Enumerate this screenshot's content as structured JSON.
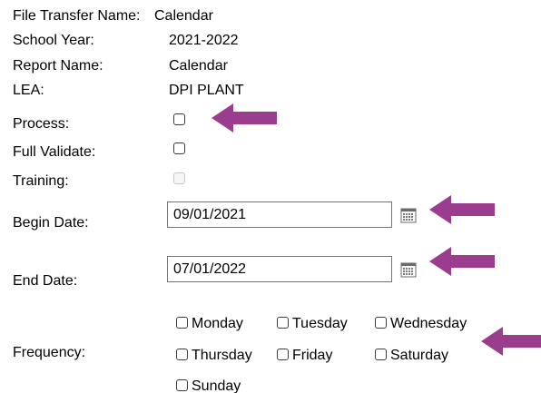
{
  "info": {
    "file_transfer_name_label": "File Transfer Name:",
    "file_transfer_name_value": "Calendar",
    "school_year_label": "School Year:",
    "school_year_value": "2021-2022",
    "report_name_label": "Report Name:",
    "report_name_value": "Calendar",
    "lea_label": "LEA:",
    "lea_value": "DPI PLANT"
  },
  "options": {
    "process_label": "Process:",
    "process_checked": false,
    "full_validate_label": "Full Validate:",
    "full_validate_checked": false,
    "training_label": "Training:",
    "training_checked": false,
    "training_disabled": true
  },
  "dates": {
    "begin_label": "Begin Date:",
    "begin_value": "09/01/2021",
    "end_label": "End Date:",
    "end_value": "07/01/2022",
    "calendar_icon": "calendar-icon"
  },
  "frequency": {
    "label": "Frequency:",
    "days": {
      "monday": "Monday",
      "tuesday": "Tuesday",
      "wednesday": "Wednesday",
      "thursday": "Thursday",
      "friday": "Friday",
      "saturday": "Saturday",
      "sunday": "Sunday"
    }
  },
  "colors": {
    "annotation_arrow": "#9b3d8f",
    "text": "#000000"
  },
  "icons": {
    "annotation": "arrow-left-icon"
  }
}
